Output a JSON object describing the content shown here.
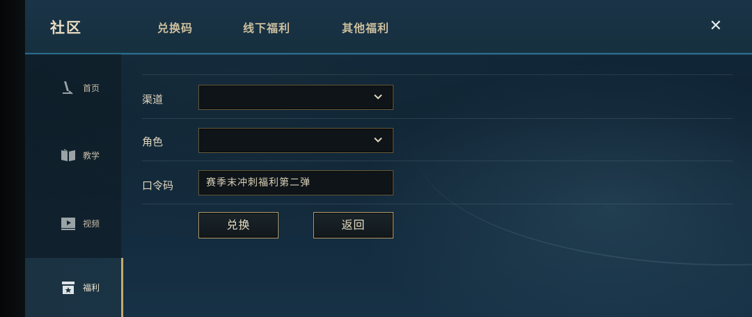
{
  "header": {
    "title": "社区",
    "tabs": [
      {
        "label": "兑换码"
      },
      {
        "label": "线下福利"
      },
      {
        "label": "其他福利"
      }
    ],
    "close_icon": "close-icon",
    "close_glyph": "✕"
  },
  "sidebar": {
    "items": [
      {
        "label": "首页",
        "icon": "sword-home-icon",
        "active": false
      },
      {
        "label": "教学",
        "icon": "book-icon",
        "active": false
      },
      {
        "label": "视频",
        "icon": "video-play-icon",
        "active": false
      },
      {
        "label": "福利",
        "icon": "gift-calendar-icon",
        "active": true
      }
    ]
  },
  "form": {
    "channel": {
      "label": "渠道",
      "value": ""
    },
    "role": {
      "label": "角色",
      "value": ""
    },
    "code": {
      "label": "口令码",
      "value": "赛季末冲刺福利第二弹",
      "placeholder": ""
    }
  },
  "actions": {
    "redeem_label": "兑换",
    "back_label": "返回"
  },
  "colors": {
    "accent_gold": "#c8aa6e",
    "header_border": "#2a6a8a",
    "text_gold": "#cdbf9e"
  }
}
